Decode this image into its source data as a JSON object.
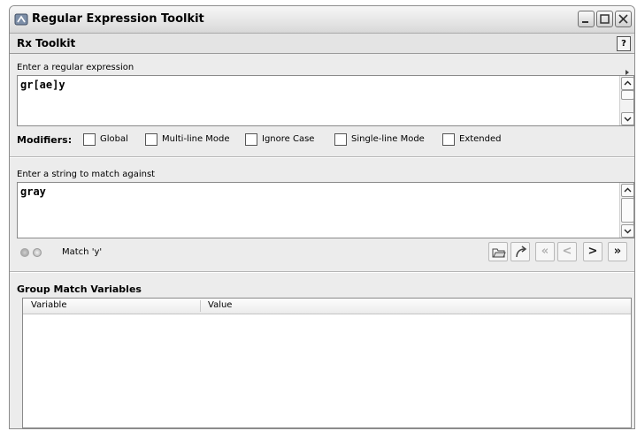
{
  "window": {
    "title": "Regular Expression Toolkit"
  },
  "menubar": {
    "title": "Rx Toolkit",
    "help_label": "?"
  },
  "regex": {
    "label": "Enter a regular expression",
    "value": "gr[ae]y"
  },
  "modifiers": {
    "label": "Modifiers:",
    "items": [
      {
        "label": "Global",
        "checked": false
      },
      {
        "label": "Multi-line Mode",
        "checked": false
      },
      {
        "label": "Ignore Case",
        "checked": false
      },
      {
        "label": "Single-line Mode",
        "checked": false
      },
      {
        "label": "Extended",
        "checked": false
      }
    ]
  },
  "target": {
    "label": "Enter a string to match against",
    "value": "gray"
  },
  "status": {
    "match_text": "Match 'y'"
  },
  "navigation": {
    "first": "«",
    "prev": "<",
    "next": ">",
    "last": "»"
  },
  "group_match": {
    "title": "Group Match Variables",
    "columns": [
      "Variable",
      "Value"
    ],
    "rows": []
  },
  "icons": [
    "app-icon",
    "minimize-icon",
    "maximize-icon",
    "close-icon",
    "help-icon",
    "open-folder-icon",
    "replace-icon",
    "match-status-icon"
  ]
}
